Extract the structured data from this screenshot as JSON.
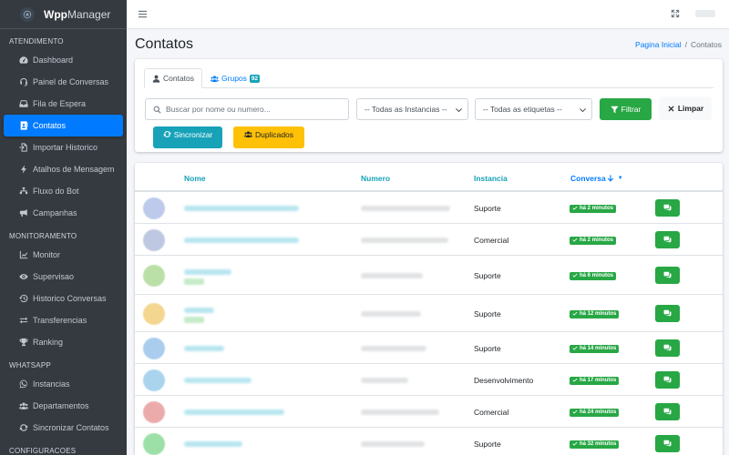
{
  "app": {
    "brand": "WppManager",
    "brand_bold": "Wpp",
    "brand_light": "Manager"
  },
  "sidebar": {
    "sections": [
      {
        "header": "ATENDIMENTO",
        "items": [
          {
            "label": "Dashboard",
            "icon": "tachometer-icon",
            "active": false
          },
          {
            "label": "Painel de Conversas",
            "icon": "headset-icon",
            "active": false
          },
          {
            "label": "Fila de Espera",
            "icon": "inbox-icon",
            "active": false
          },
          {
            "label": "Contatos",
            "icon": "address-book-icon",
            "active": true
          },
          {
            "label": "Importar Historico",
            "icon": "file-import-icon",
            "active": false
          },
          {
            "label": "Atalhos de Mensagem",
            "icon": "bolt-icon",
            "active": false
          },
          {
            "label": "Fluxo do Bot",
            "icon": "sitemap-icon",
            "active": false
          },
          {
            "label": "Campanhas",
            "icon": "bullhorn-icon",
            "active": false
          }
        ]
      },
      {
        "header": "MONITORAMENTO",
        "items": [
          {
            "label": "Monitor",
            "icon": "chart-line-icon",
            "active": false
          },
          {
            "label": "Supervisao",
            "icon": "eye-icon",
            "active": false
          },
          {
            "label": "Historico Conversas",
            "icon": "history-icon",
            "active": false
          },
          {
            "label": "Transferencias",
            "icon": "exchange-icon",
            "active": false
          },
          {
            "label": "Ranking",
            "icon": "trophy-icon",
            "active": false
          }
        ]
      },
      {
        "header": "WHATSAPP",
        "items": [
          {
            "label": "Instancias",
            "icon": "whatsapp-icon",
            "active": false
          },
          {
            "label": "Departamentos",
            "icon": "users-icon",
            "active": false
          },
          {
            "label": "Sincronizar Contatos",
            "icon": "sync-icon",
            "active": false
          }
        ]
      },
      {
        "header": "CONFIGURACOES",
        "items": []
      }
    ]
  },
  "header": {
    "title": "Contatos",
    "breadcrumb": [
      {
        "label": "Pagina Inicial"
      },
      {
        "label": "Contatos"
      }
    ]
  },
  "filters": {
    "tabs": [
      {
        "label": "Contatos",
        "icon": "user-icon",
        "active": true,
        "badge": ""
      },
      {
        "label": "Grupos",
        "icon": "users-icon",
        "active": false,
        "badge": "92"
      }
    ],
    "search_placeholder": "Buscar por nome ou numero...",
    "instance_select": "-- Todas as Instancias --",
    "tag_select": "-- Todas as etiquetas --",
    "filter_label": "Filtrar",
    "clear_label": "Limpar",
    "sync_label": "Sincronizar",
    "duplicates_label": "Duplicados"
  },
  "table": {
    "columns": {
      "name": "Nome",
      "number": "Numero",
      "instance": "Instancia",
      "conversation": "Conversa"
    },
    "rows": [
      {
        "instance": "Suporte",
        "last": "há 2 minutos",
        "avatar_color": "#a9b9e6",
        "has_tag": false
      },
      {
        "instance": "Comercial",
        "last": "há 2 minutos",
        "avatar_color": "#aab6d9",
        "has_tag": false
      },
      {
        "instance": "Suporte",
        "last": "há 6 minutos",
        "avatar_color": "#a4d68c",
        "has_tag": true
      },
      {
        "instance": "Suporte",
        "last": "há 12 minutos",
        "avatar_color": "#f0c96a",
        "has_tag": true
      },
      {
        "instance": "Suporte",
        "last": "há 14 minutos",
        "avatar_color": "#8fbde8",
        "has_tag": false
      },
      {
        "instance": "Desenvolvimento",
        "last": "há 17 minutos",
        "avatar_color": "#8ec6e8",
        "has_tag": false
      },
      {
        "instance": "Comercial",
        "last": "há 24 minutos",
        "avatar_color": "#e59090",
        "has_tag": false
      },
      {
        "instance": "Suporte",
        "last": "há 32 minutos",
        "avatar_color": "#7bd68a",
        "has_tag": false
      }
    ]
  }
}
